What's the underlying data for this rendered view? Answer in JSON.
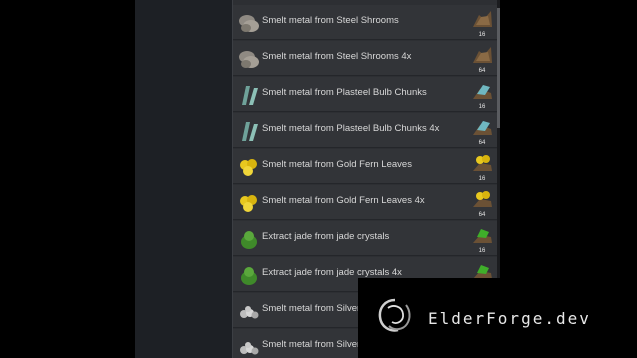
{
  "recipes": [
    {
      "label": "Smelt metal from Steel Shrooms",
      "count": "16",
      "input_icon": "steel-shroom-icon",
      "output_icon": "steel-ore-pile-icon"
    },
    {
      "label": "Smelt metal from Steel Shrooms 4x",
      "count": "64",
      "input_icon": "steel-shroom-icon",
      "output_icon": "steel-ore-pile-icon"
    },
    {
      "label": "Smelt metal from Plasteel Bulb Chunks",
      "count": "16",
      "input_icon": "plasteel-bulb-chunk-icon",
      "output_icon": "plasteel-pile-icon"
    },
    {
      "label": "Smelt metal from Plasteel Bulb Chunks 4x",
      "count": "64",
      "input_icon": "plasteel-bulb-chunk-icon",
      "output_icon": "plasteel-pile-icon"
    },
    {
      "label": "Smelt metal from Gold Fern Leaves",
      "count": "16",
      "input_icon": "gold-fern-leaf-icon",
      "output_icon": "gold-pile-icon"
    },
    {
      "label": "Smelt metal from Gold Fern Leaves 4x",
      "count": "64",
      "input_icon": "gold-fern-leaf-icon",
      "output_icon": "gold-pile-icon"
    },
    {
      "label": "Extract jade from jade crystals",
      "count": "16",
      "input_icon": "jade-crystal-icon",
      "output_icon": "jade-pile-icon"
    },
    {
      "label": "Extract jade from jade crystals 4x",
      "count": "",
      "input_icon": "jade-crystal-icon",
      "output_icon": "jade-pile-icon"
    },
    {
      "label": "Smelt metal from Silver",
      "count": "",
      "input_icon": "silver-nugget-icon",
      "output_icon": ""
    },
    {
      "label": "Smelt metal from Silver",
      "count": "",
      "input_icon": "silver-nugget-icon",
      "output_icon": ""
    }
  ],
  "watermark": {
    "brand": "ElderForge.dev",
    "logo_icon": "swirl-logo-icon"
  },
  "colors": {
    "list_bg": "#2d2f33",
    "row_bg": "#323438",
    "text": "#d8d8d8",
    "side_panel": "#1d2025"
  }
}
